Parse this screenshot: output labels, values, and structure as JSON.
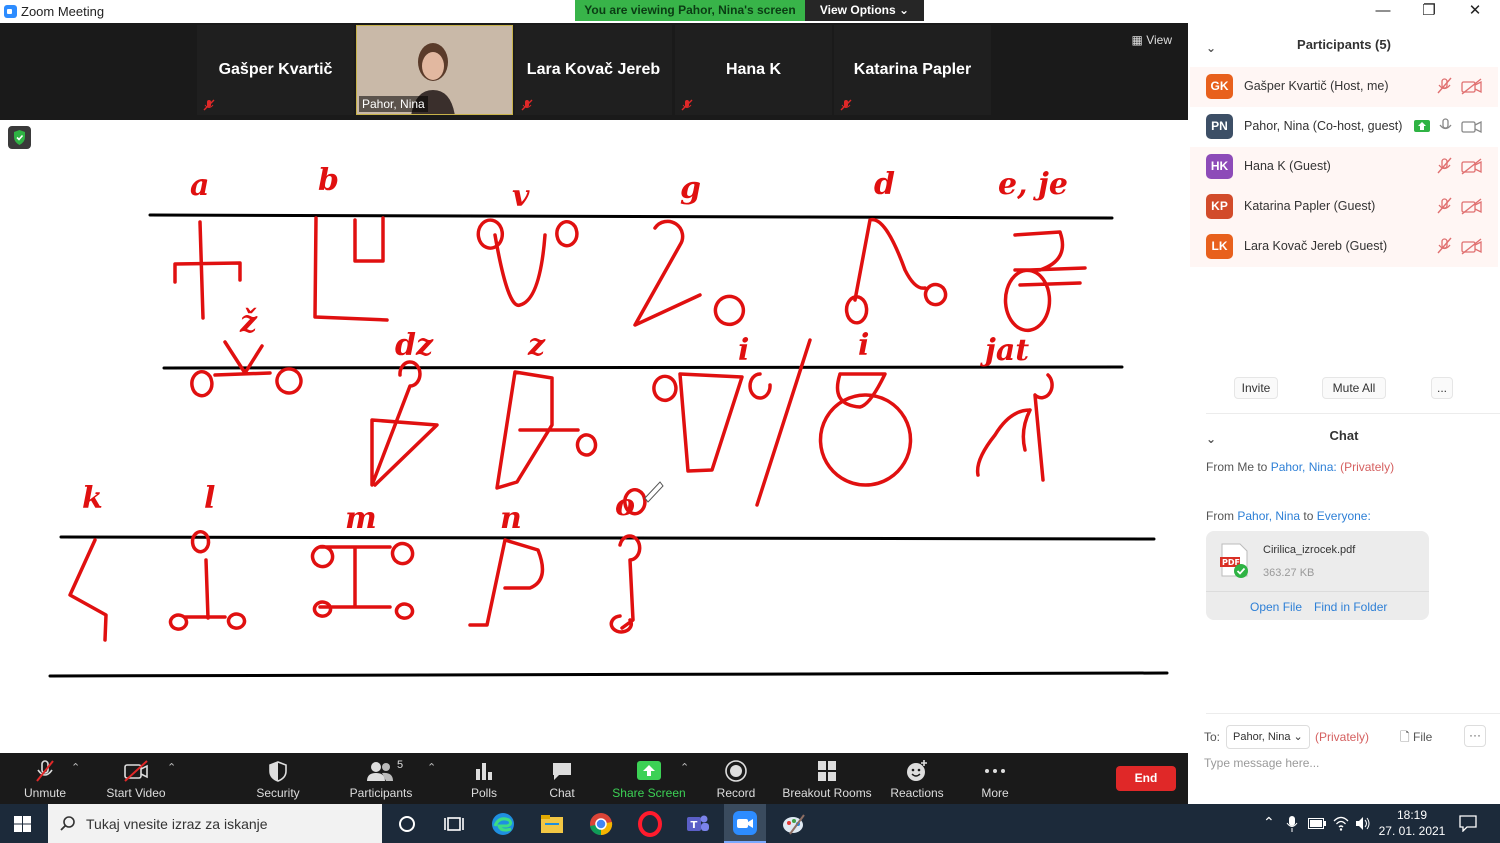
{
  "window": {
    "title": "Zoom Meeting"
  },
  "share_banner": {
    "viewing": "You are viewing Pahor, Nina's screen",
    "view_options": "View Options"
  },
  "video_strip": {
    "view_label": "View",
    "tiles": [
      {
        "name": "Gašper Kvartič"
      },
      {
        "name": "Pahor, Nina"
      },
      {
        "name": "Lara Kovač Jereb"
      },
      {
        "name": "Hana K"
      },
      {
        "name": "Katarina Papler"
      }
    ]
  },
  "whiteboard": {
    "row1": [
      "a",
      "b",
      "v",
      "g",
      "d",
      "e, je"
    ],
    "row2": [
      "ž",
      "dz",
      "z",
      "i",
      "i",
      "jat"
    ],
    "row3": [
      "k",
      "l",
      "m",
      "n",
      "o"
    ]
  },
  "toolbar": {
    "unmute": "Unmute",
    "start_video": "Start Video",
    "security": "Security",
    "participants": "Participants",
    "participants_count": "5",
    "polls": "Polls",
    "chat": "Chat",
    "share_screen": "Share Screen",
    "record": "Record",
    "breakout_rooms": "Breakout Rooms",
    "reactions": "Reactions",
    "more": "More",
    "end": "End"
  },
  "participants_panel": {
    "title": "Participants (5)",
    "people": [
      {
        "initials": "GK",
        "name": "Gašper Kvartič (Host, me)",
        "color": "#e8601c"
      },
      {
        "initials": "PN",
        "name": "Pahor, Nina (Co-host, guest)",
        "color": "#3d4f66"
      },
      {
        "initials": "HK",
        "name": "Hana K (Guest)",
        "color": "#8d4bb8"
      },
      {
        "initials": "KP",
        "name": "Katarina Papler (Guest)",
        "color": "#d24b2a"
      },
      {
        "initials": "LK",
        "name": "Lara Kovač Jereb (Guest)",
        "color": "#e8601c"
      }
    ],
    "invite": "Invite",
    "mute_all": "Mute All",
    "more": "..."
  },
  "chat_panel": {
    "title": "Chat",
    "msg1": {
      "prefix": "From Me to",
      "to": "Pahor, Nina:",
      "privately": "(Privately)"
    },
    "msg2": {
      "prefix": "From",
      "from": "Pahor, Nina",
      "mid": "to",
      "to": "Everyone:"
    },
    "file": {
      "name": "Cirilica_izrocek.pdf",
      "size": "363.27 KB",
      "open": "Open File",
      "find": "Find in Folder",
      "badge": "PDF"
    },
    "to_label": "To:",
    "recipient": "Pahor, Nina",
    "privately": "(Privately)",
    "file_btn": "File",
    "more": "···",
    "placeholder": "Type message here..."
  },
  "taskbar": {
    "search_text": "Tukaj vnesite izraz za iskanje",
    "time": "18:19",
    "date": "27. 01. 2021"
  }
}
